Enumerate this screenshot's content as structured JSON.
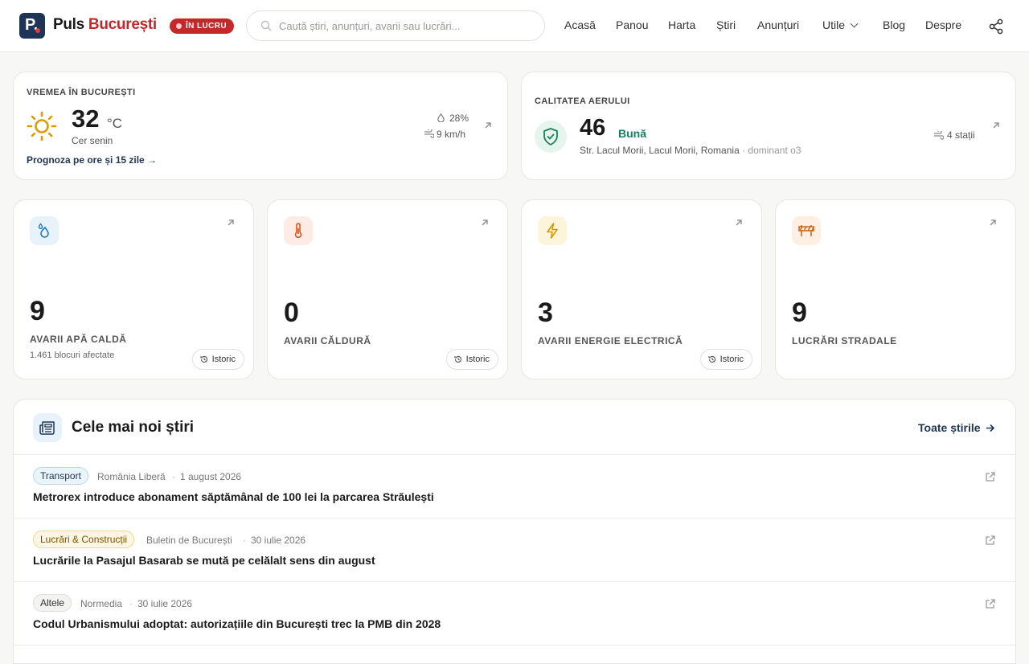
{
  "brand": {
    "name_part1": "Puls",
    "name_part2": "București",
    "logo_letter": "P.",
    "status_badge": "ÎN LUCRU"
  },
  "search": {
    "placeholder": "Caută știri, anunțuri, avarii sau lucrări..."
  },
  "nav": {
    "items": [
      "Acasă",
      "Panou",
      "Harta",
      "Știri",
      "Anunțuri",
      "Utile",
      "Blog",
      "Despre"
    ]
  },
  "weather": {
    "title": "VREMEA ÎN BUCUREȘTI",
    "temperature": "32",
    "unit": "°C",
    "condition": "Cer senin",
    "humidity": "28%",
    "wind": "9 km/h",
    "forecast_link": "Prognoza pe ore și 15 zile →"
  },
  "air": {
    "title": "CALITATEA AERULUI",
    "index": "46",
    "rating": "Bună",
    "location": "Str. Lacul Morii, Lacul Morii, Romania",
    "dominant": "· dominant o3",
    "stations": "4 stații"
  },
  "stats": [
    {
      "value": "9",
      "label": "AVARII APĂ CALDĂ",
      "sub": "1.461 blocuri afectate",
      "history": "Istoric",
      "icon": "water-drops-icon"
    },
    {
      "value": "0",
      "label": "AVARII CĂLDURĂ",
      "history": "Istoric",
      "icon": "thermometer-icon"
    },
    {
      "value": "3",
      "label": "AVARII ENERGIE ELECTRICĂ",
      "history": "Istoric",
      "icon": "lightning-icon"
    },
    {
      "value": "9",
      "label": "LUCRĂRI STRADALE",
      "icon": "road-barrier-icon"
    }
  ],
  "news": {
    "title": "Cele mai noi știri",
    "all_link": "Toate știrile",
    "items": [
      {
        "tag": "Transport",
        "source": "România Liberă",
        "date": "1 august 2026",
        "title": "Metrorex introduce abonament săptămânal de 100 lei la parcarea Străulești"
      },
      {
        "tag": "Lucrări & Construcții",
        "source": "Buletin de București",
        "date": "30 iulie 2026",
        "title": "Lucrările la Pasajul Basarab se mută pe celălalt sens din august"
      },
      {
        "tag": "Altele",
        "source": "Normedia",
        "date": "30 iulie 2026",
        "title": "Codul Urbanismului adoptat: autorizațiile din București trec la PMB din 2028"
      }
    ]
  },
  "colors": {
    "brand_dark": "#1f3557",
    "brand_red": "#c62828",
    "air_good": "#16805b"
  }
}
